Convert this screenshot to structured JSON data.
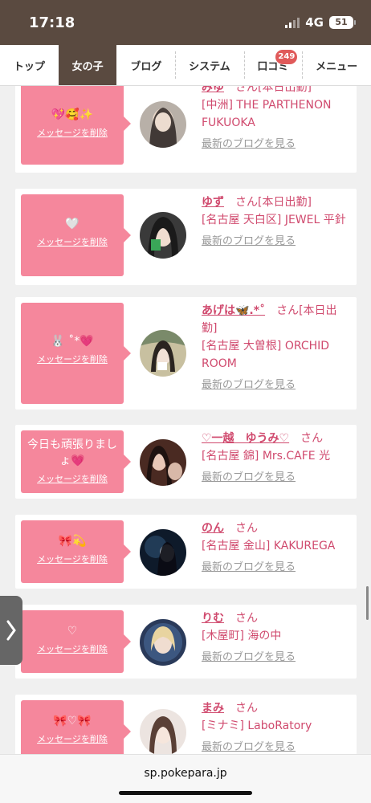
{
  "status": {
    "time": "17:18",
    "network": "4G",
    "battery": "51"
  },
  "nav": {
    "items": [
      {
        "label": "トップ"
      },
      {
        "label": "女の子"
      },
      {
        "label": "ブログ"
      },
      {
        "label": "システム"
      },
      {
        "label": "口コミ",
        "badge": "249"
      },
      {
        "label": "メニュー"
      }
    ],
    "active_index": 1
  },
  "delete_label": "メッセージを削除",
  "san": "さん",
  "blog_label": "最新のブログを見る",
  "cards": [
    {
      "message": "💖🥰✨",
      "name": "みゆ",
      "suffix": "[本日出勤]",
      "shop": "[中洲] THE PARTHENON FUKUOKA"
    },
    {
      "message": "🤍",
      "name": "ゆず",
      "suffix": "[本日出勤]",
      "shop": "[名古屋 天白区] JEWEL 平針"
    },
    {
      "message": "🐰 ˚*💗",
      "name": "あげは🦋.*˚",
      "suffix": "[本日出勤]",
      "shop": "[名古屋 大曽根] ORCHID ROOM"
    },
    {
      "message": "今日も頑張りましょ💗",
      "name": "♡一越　ゆうみ♡",
      "suffix": "",
      "shop": "[名古屋 錦] Mrs.CAFE 光"
    },
    {
      "message": "🎀💫",
      "name": "のん",
      "suffix": "",
      "shop": "[名古屋 金山] KAKUREGA"
    },
    {
      "message": "♡",
      "name": "りむ",
      "suffix": "",
      "shop": "[木屋町] 海の中"
    },
    {
      "message": "🎀♡🎀",
      "name": "まみ",
      "suffix": "",
      "shop": "[ミナミ] LaboRatory"
    }
  ],
  "url": "sp.pokepara.jp",
  "colors": {
    "header": "#5a4a40",
    "bubble": "#f5879c",
    "accent": "#d04a6e",
    "badge": "#e05a5a"
  }
}
